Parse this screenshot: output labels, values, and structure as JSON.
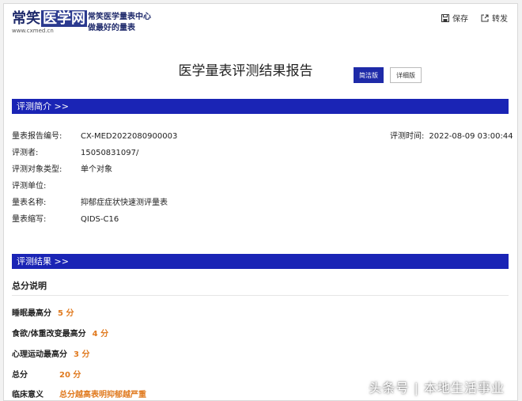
{
  "brand": {
    "logo_text": "常笑",
    "logo_box": "医学网",
    "url": "www.cxmed.cn",
    "slogan_line1": "常笑医学量表中心",
    "slogan_line2": "做最好的量表"
  },
  "actions": {
    "save": "保存",
    "share": "转发"
  },
  "report": {
    "title": "医学量表评测结果报告",
    "btn_simple": "简洁版",
    "btn_detail": "详细版"
  },
  "sections": {
    "intro": "评测简介 >>",
    "result": "评测结果 >>"
  },
  "intro": {
    "rows": [
      {
        "label": "量表报告编号:",
        "value": "CX-MED2022080900003"
      },
      {
        "label": "评测者:",
        "value": "15050831097/"
      },
      {
        "label": "评测对象类型:",
        "value": "单个对象"
      },
      {
        "label": "评测单位:",
        "value": ""
      },
      {
        "label": "量表名称:",
        "value": "抑郁症症状快速测评量表"
      },
      {
        "label": "量表缩写:",
        "value": "QIDS-C16"
      }
    ],
    "time_label": "评测时间:",
    "time_value": "2022-08-09 03:00:44"
  },
  "result": {
    "subtitle": "总分说明",
    "items": [
      {
        "label": "睡眠最高分",
        "value": "5 分"
      },
      {
        "label": "食欲/体重改变最高分",
        "value": "4 分"
      },
      {
        "label": "心理运动最高分",
        "value": "3 分"
      },
      {
        "label": "总分",
        "value": "20 分"
      },
      {
        "label": "临床意义",
        "value": "总分越高表明抑郁越严重"
      }
    ]
  },
  "watermark": "头条号 | 本地生活事业",
  "colors": {
    "bar": "#1a24b5",
    "accent": "#e07a1f",
    "brand": "#1f2a6b"
  }
}
